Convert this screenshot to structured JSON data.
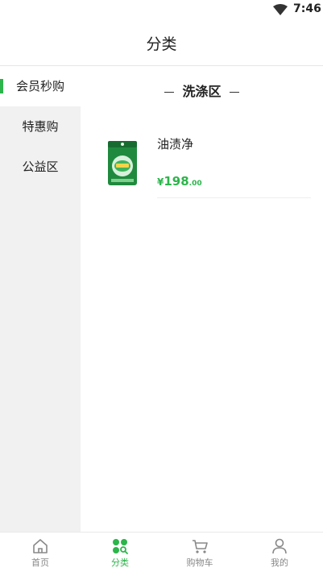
{
  "status_bar": {
    "time": "7:46",
    "wifi_icon": "wifi-icon"
  },
  "header": {
    "title": "分类"
  },
  "sidebar": {
    "items": [
      {
        "label": "会员秒购",
        "active": true
      },
      {
        "label": "特惠购",
        "active": false
      },
      {
        "label": "公益区",
        "active": false
      }
    ]
  },
  "section": {
    "title": "洗涤区"
  },
  "products": [
    {
      "name": "油渍净",
      "currency": "¥",
      "price_int": "198",
      "price_dec": ".00",
      "thumb_icon": "detergent-bag-image"
    }
  ],
  "tabbar": {
    "tabs": [
      {
        "label": "首页",
        "icon": "home-icon",
        "active": false
      },
      {
        "label": "分类",
        "icon": "category-icon",
        "active": true
      },
      {
        "label": "购物车",
        "icon": "cart-icon",
        "active": false
      },
      {
        "label": "我的",
        "icon": "user-icon",
        "active": false
      }
    ]
  },
  "colors": {
    "accent": "#2bb54a",
    "sidebar_bg": "#f1f1f1",
    "text": "#222222",
    "muted": "#888888"
  }
}
